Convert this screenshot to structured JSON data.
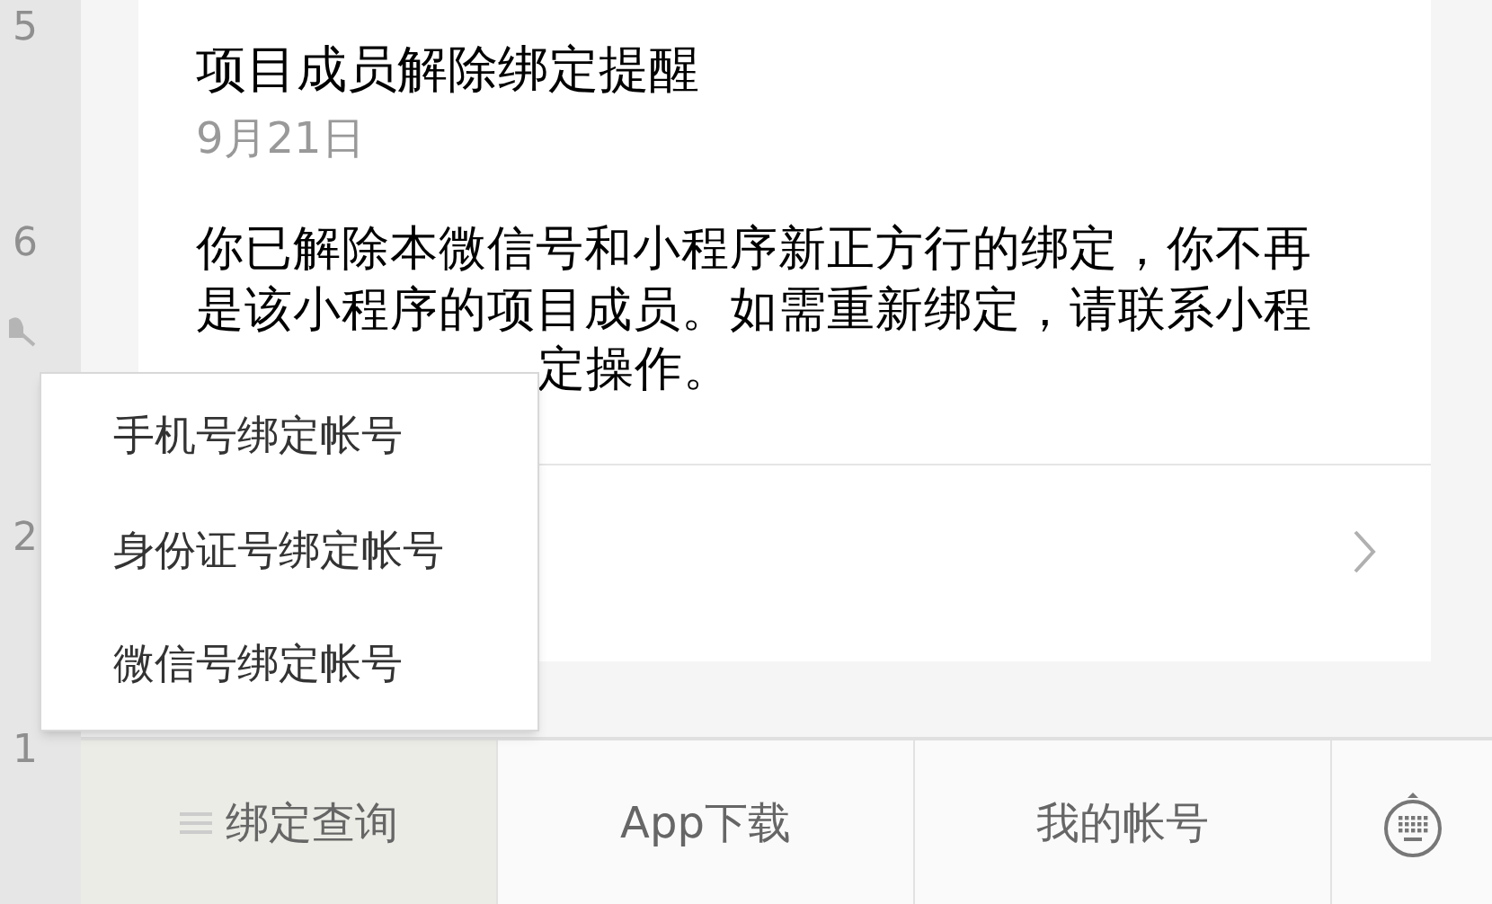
{
  "chat_list": {
    "times": [
      "5",
      "6",
      "2",
      "1"
    ]
  },
  "message": {
    "title": "项目成员解除绑定提醒",
    "date": "9月21日",
    "body": "你已解除本微信号和小程序新正方行的绑定，你不再是该小程序的项目成员。如需重新绑定，请联系小程",
    "body_tail": "定操作。"
  },
  "menu_popup": {
    "items": [
      "手机号绑定帐号",
      "身份证号绑定帐号",
      "微信号绑定帐号"
    ]
  },
  "bottom_menu": [
    {
      "label": "绑定查询",
      "selected": true,
      "has_submenu": true
    },
    {
      "label": "App下载",
      "selected": false,
      "has_submenu": false
    },
    {
      "label": "我的帐号",
      "selected": false,
      "has_submenu": false
    }
  ]
}
